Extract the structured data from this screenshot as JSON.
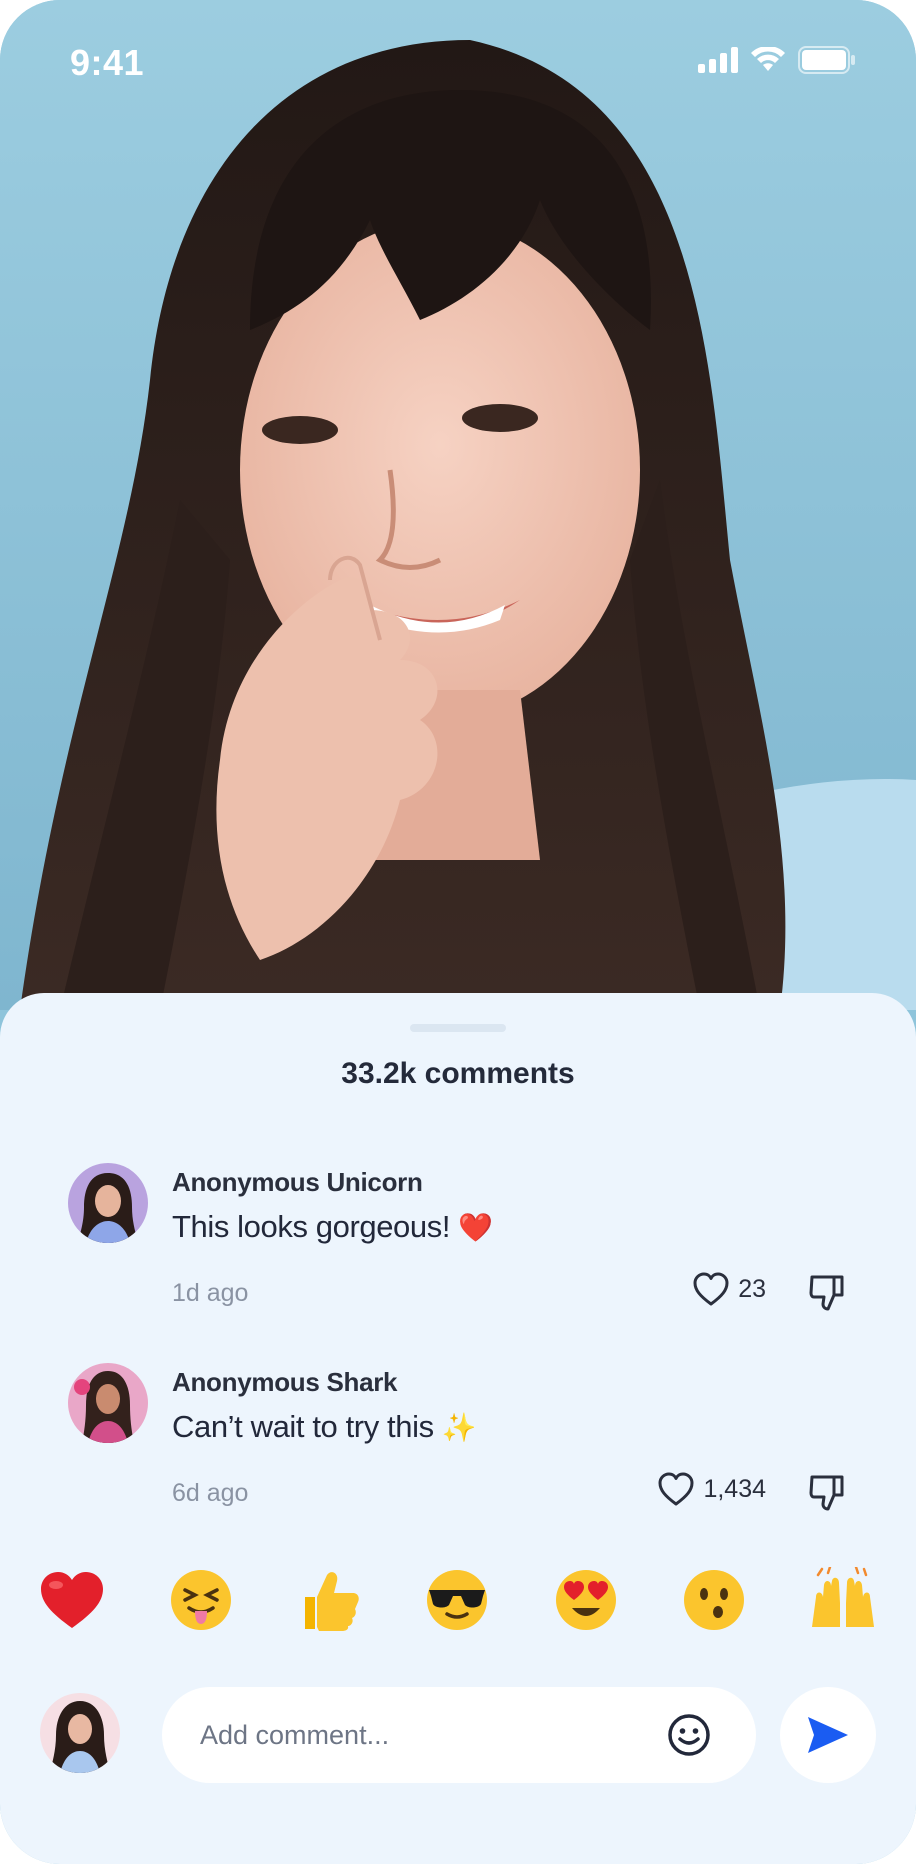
{
  "status_bar": {
    "time": "9:41",
    "icons": [
      "cellular-signal-icon",
      "wifi-icon",
      "battery-icon"
    ]
  },
  "hero": {
    "description_icon": "portrait-photo"
  },
  "sheet": {
    "title": "33.2k comments"
  },
  "comments": [
    {
      "author": "Anonymous Unicorn",
      "text": "This looks gorgeous!",
      "emoji": "❤️",
      "time": "1d ago",
      "likes": "23"
    },
    {
      "author": "Anonymous Shark",
      "text": "Can’t wait to try this",
      "emoji": "✨",
      "time": "6d ago",
      "likes": "1,434"
    }
  ],
  "reactions": [
    "heart",
    "squinting-tongue",
    "thumbs-up",
    "sunglasses",
    "heart-eyes",
    "hushed",
    "raising-hands"
  ],
  "composer": {
    "placeholder": "Add comment..."
  },
  "colors": {
    "accent": "#1a5cf2",
    "sheet_bg": "#edf5fd",
    "text_primary": "#22283a",
    "text_secondary": "#8a93a3"
  }
}
